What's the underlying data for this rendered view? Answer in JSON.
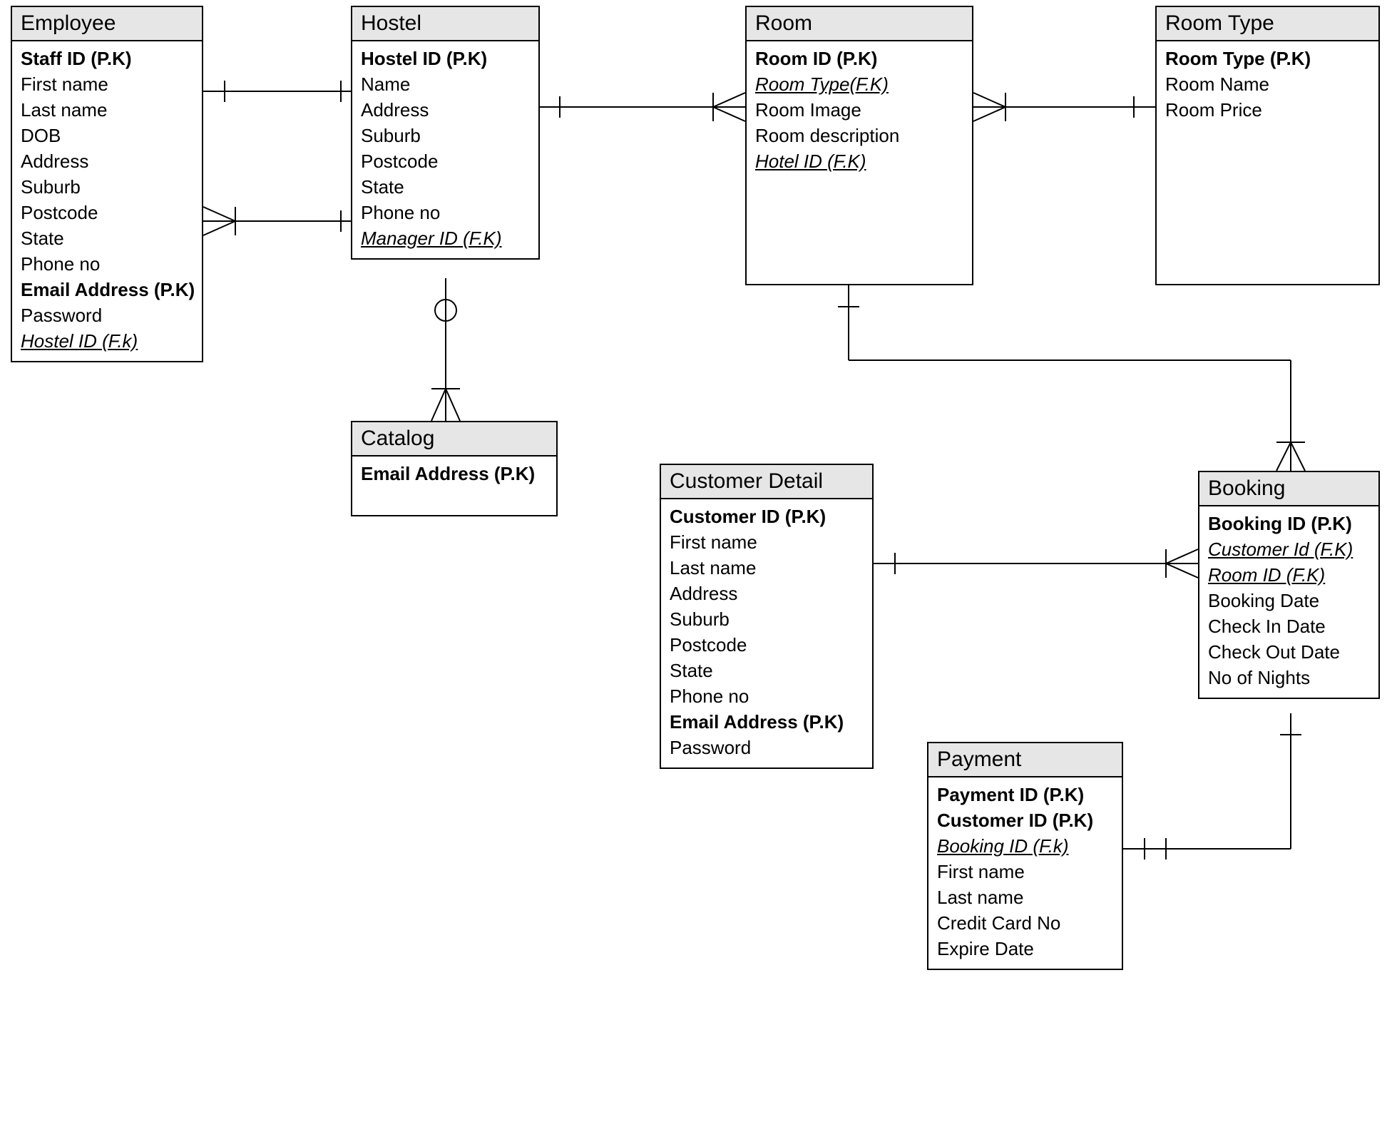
{
  "entities": {
    "employee": {
      "title": "Employee",
      "attrs": [
        {
          "text": "Staff ID (P.K)",
          "pk": true
        },
        {
          "text": "First name"
        },
        {
          "text": "Last name"
        },
        {
          "text": "DOB"
        },
        {
          "text": "Address"
        },
        {
          "text": "Suburb"
        },
        {
          "text": "Postcode"
        },
        {
          "text": "State"
        },
        {
          "text": "Phone no"
        },
        {
          "text": "Email Address (P.K)",
          "pk": true
        },
        {
          "text": "Password"
        },
        {
          "text": "Hostel ID (F.k)",
          "fk": true
        }
      ]
    },
    "hostel": {
      "title": "Hostel",
      "attrs": [
        {
          "text": "Hostel ID (P.K)",
          "pk": true
        },
        {
          "text": "Name"
        },
        {
          "text": "Address"
        },
        {
          "text": "Suburb"
        },
        {
          "text": "Postcode"
        },
        {
          "text": "State"
        },
        {
          "text": "Phone no"
        },
        {
          "text": "Manager ID (F.K)",
          "fk": true
        }
      ]
    },
    "room": {
      "title": "Room",
      "attrs": [
        {
          "text": "Room ID (P.K)",
          "pk": true
        },
        {
          "text": "Room Type(F.K)",
          "fk": true
        },
        {
          "text": "Room Image"
        },
        {
          "text": "Room description"
        },
        {
          "text": "Hotel  ID (F.K)",
          "fk": true
        }
      ]
    },
    "roomtype": {
      "title": "Room Type",
      "attrs": [
        {
          "text": "Room Type (P.K)",
          "pk": true
        },
        {
          "text": "Room Name"
        },
        {
          "text": "Room Price"
        }
      ]
    },
    "catalog": {
      "title": "Catalog",
      "attrs": [
        {
          "text": "Email Address (P.K)",
          "pk": true
        }
      ]
    },
    "customer": {
      "title": "Customer Detail",
      "attrs": [
        {
          "text": "Customer ID (P.K)",
          "pk": true
        },
        {
          "text": "First name"
        },
        {
          "text": "Last name"
        },
        {
          "text": "Address"
        },
        {
          "text": "Suburb"
        },
        {
          "text": "Postcode"
        },
        {
          "text": "State"
        },
        {
          "text": "Phone no"
        },
        {
          "text": "Email Address (P.K)",
          "pk": true
        },
        {
          "text": "Password"
        }
      ]
    },
    "booking": {
      "title": "Booking",
      "attrs": [
        {
          "text": "Booking ID (P.K)",
          "pk": true
        },
        {
          "text": "Customer Id (F.K)",
          "fk": true
        },
        {
          "text": "Room ID (F.K)",
          "fk": true
        },
        {
          "text": "Booking Date"
        },
        {
          "text": "Check In Date"
        },
        {
          "text": "Check Out Date"
        },
        {
          "text": "No of Nights"
        }
      ]
    },
    "payment": {
      "title": "Payment",
      "attrs": [
        {
          "text": "Payment ID (P.K)",
          "pk": true
        },
        {
          "text": "Customer ID (P.K)",
          "pk": true
        },
        {
          "text": "Booking ID (F.k)",
          "fk": true
        },
        {
          "text": "First name"
        },
        {
          "text": "Last name"
        },
        {
          "text": "Credit Card No"
        },
        {
          "text": "Expire Date"
        }
      ]
    }
  }
}
